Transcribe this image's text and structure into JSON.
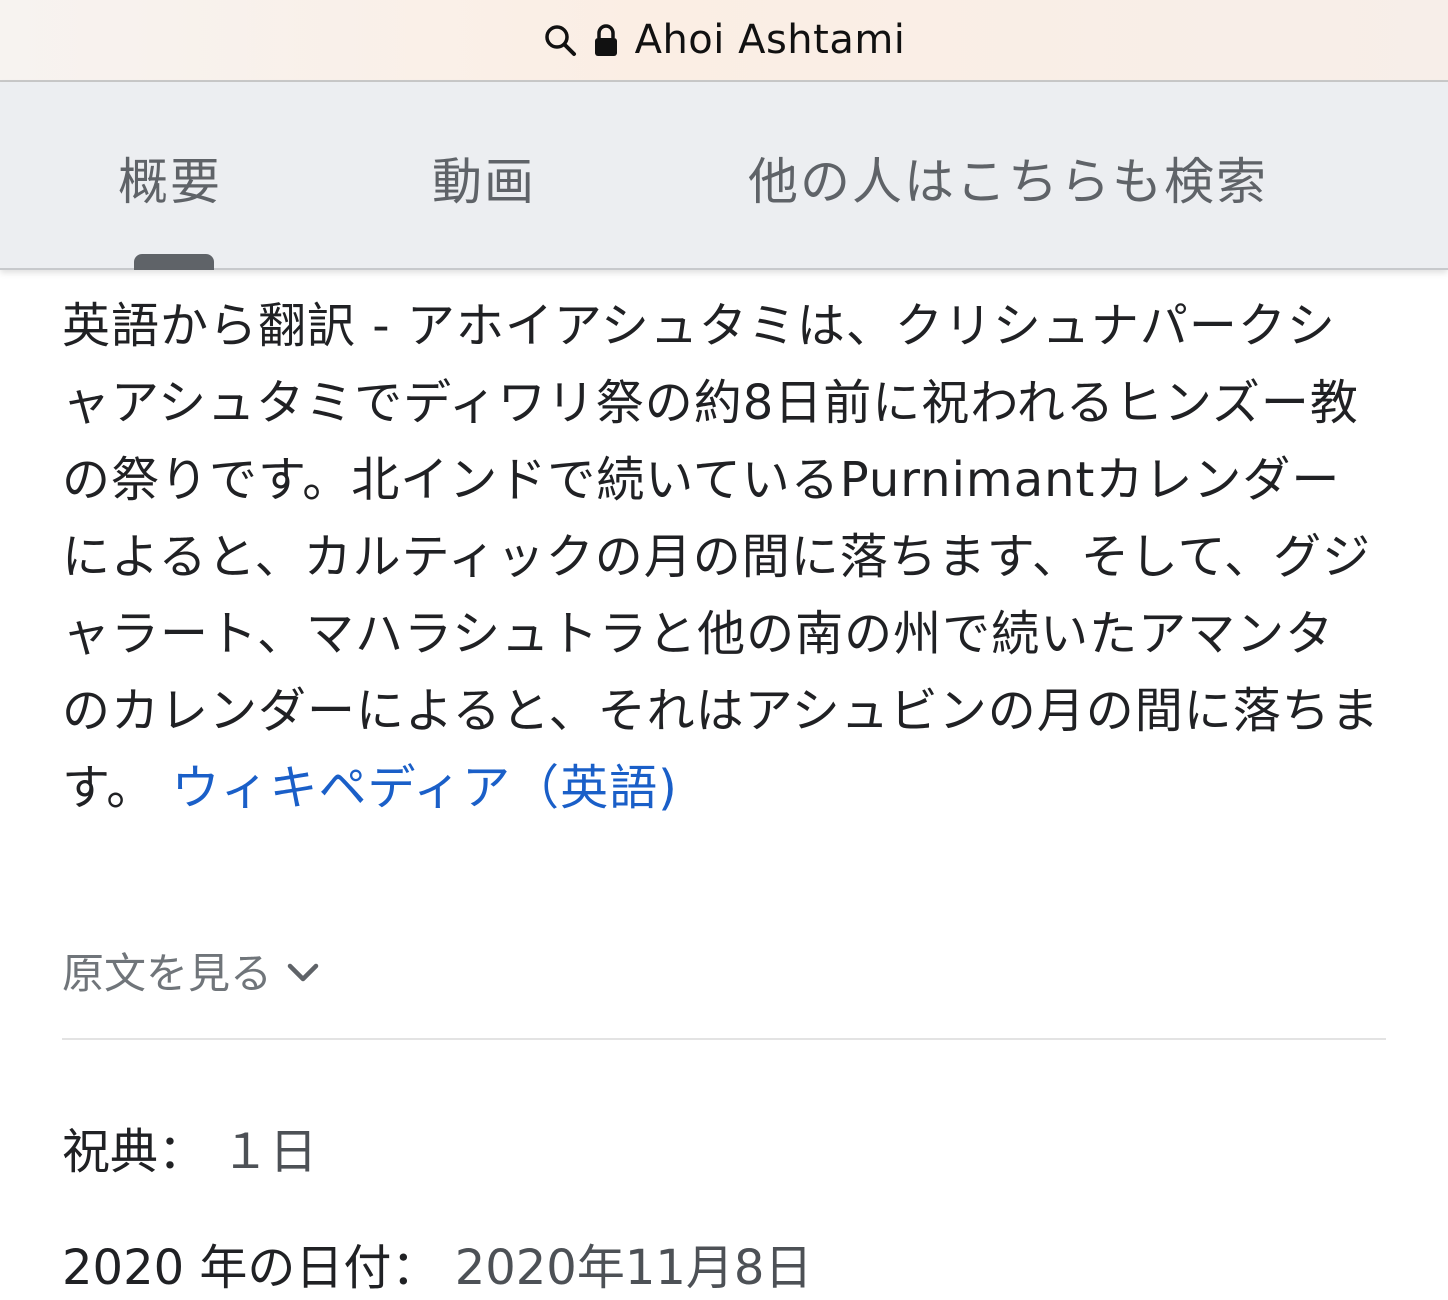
{
  "address_bar": {
    "title": "Ahoi Ashtami",
    "icons": [
      "search-icon",
      "lock-icon"
    ]
  },
  "tabs": {
    "items": [
      {
        "label": "概要",
        "selected": true
      },
      {
        "label": "動画",
        "selected": false
      },
      {
        "label": "他の人はこちらも検索",
        "selected": false
      }
    ]
  },
  "description": {
    "text": "英語から翻訳 - アホイアシュタミは、クリシュナパークシャアシュタミでディワリ祭の約8日前に祝われるヒンズー教の祭りです。北インドで続いているPurnimantカレンダーによると、カルティックの月の間に落ちます、そして、グジャラート、マハラシュトラと他の南の州で続いたアマンタのカレンダーによると、それはアシュビンの月の間に落ちます。",
    "source_link": "ウィキペディア（英語)"
  },
  "see_original": {
    "label": "原文を見る",
    "icon": "chevron-down-icon"
  },
  "facts": [
    {
      "label": "祝典：",
      "value": "１日"
    },
    {
      "label": "2020 年の日付：",
      "value": "2020年11月8日"
    }
  ],
  "colors": {
    "link": "#1a5fc8",
    "text": "#202124",
    "muted": "#70757a",
    "tab_bar": "#eceef1"
  }
}
